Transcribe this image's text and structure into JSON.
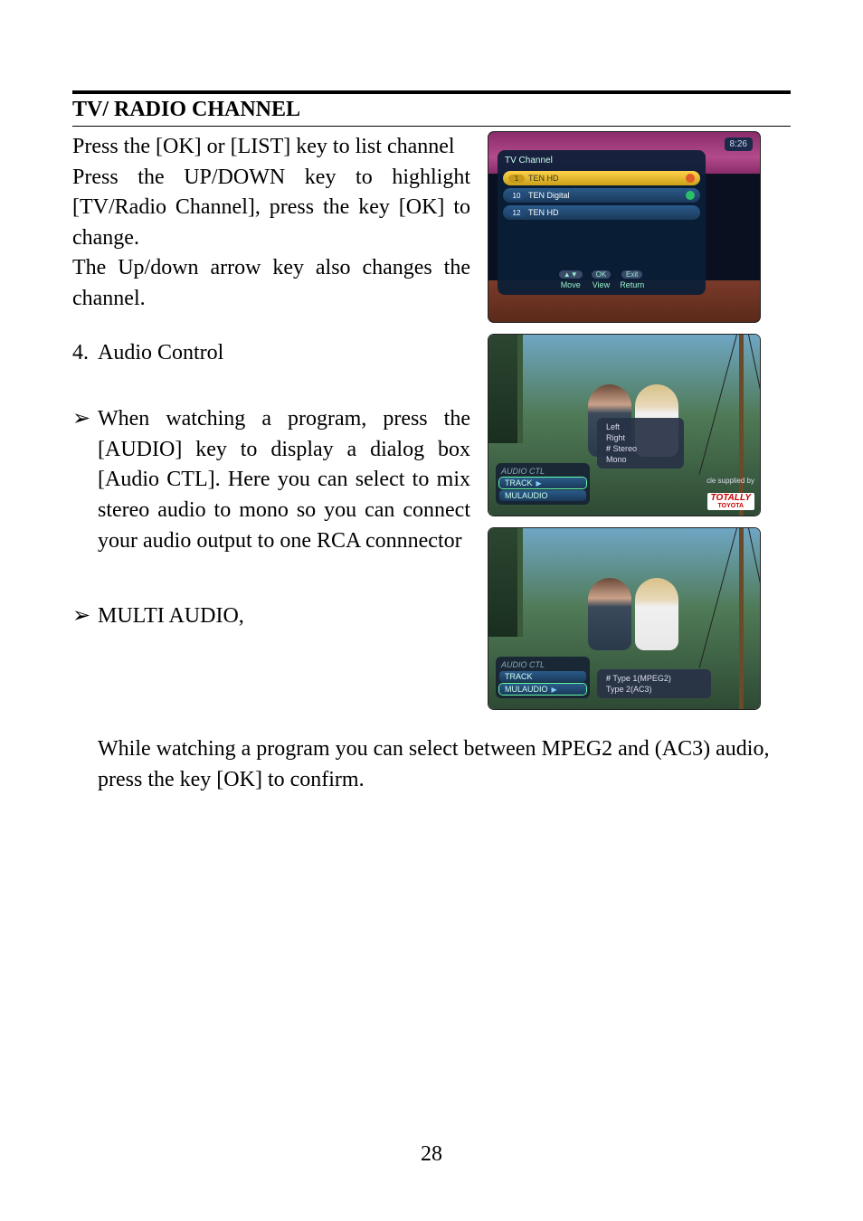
{
  "section_title": "TV/ RADIO CHANNEL",
  "intro": {
    "p1": "Press the [OK] or [LIST] key to list channel",
    "p2": "Press the UP/DOWN key to highlight [TV/Radio Channel], press the key [OK] to change.",
    "p3": "The Up/down arrow key also changes the channel."
  },
  "item4": {
    "number": "4.",
    "title": "Audio Control"
  },
  "bullet1": {
    "marker": "➢",
    "text": "When watching a program, press the [AUDIO] key to display a dialog box [Audio CTL]. Here you can select to mix stereo audio to mono so you can connect your audio output to one RCA connnector"
  },
  "bullet2": {
    "marker": "➢",
    "title": "MULTI AUDIO,",
    "text": "While watching a program you can select between MPEG2 and (AC3) audio, press the key [OK] to confirm."
  },
  "page_number": "28",
  "screenshots": {
    "s1": {
      "clock": "8:26",
      "panel_title": "TV Channel",
      "rows": [
        {
          "num": "1",
          "name": "TEN HD",
          "badge": "fav",
          "selected": true
        },
        {
          "num": "10",
          "name": "TEN Digital",
          "badge": "lock",
          "selected": false
        },
        {
          "num": "12",
          "name": "TEN HD",
          "badge": "",
          "selected": false
        }
      ],
      "hints": {
        "move": {
          "key": "▲▼",
          "label": "Move"
        },
        "view": {
          "key": "OK",
          "label": "View"
        },
        "return": {
          "key": "Exit",
          "label": "Return"
        }
      }
    },
    "s2": {
      "panel_title": "AUDIO CTL",
      "rows": {
        "track": "TRACK",
        "mul": "MULAUDIO"
      },
      "options": {
        "left": "Left",
        "right": "Right",
        "stereo": "Stereo",
        "mono": "Mono",
        "selected": "stereo"
      },
      "supplied": "cle supplied by",
      "logo": {
        "main": "TOTALLY",
        "sub": "TOYOTA"
      }
    },
    "s3": {
      "panel_title": "AUDIO CTL",
      "rows": {
        "track": "TRACK",
        "mul": "MULAUDIO"
      },
      "options": {
        "opt1": "Type 1(MPEG2)",
        "opt2": "Type 2(AC3)",
        "selected": "opt1"
      }
    }
  }
}
